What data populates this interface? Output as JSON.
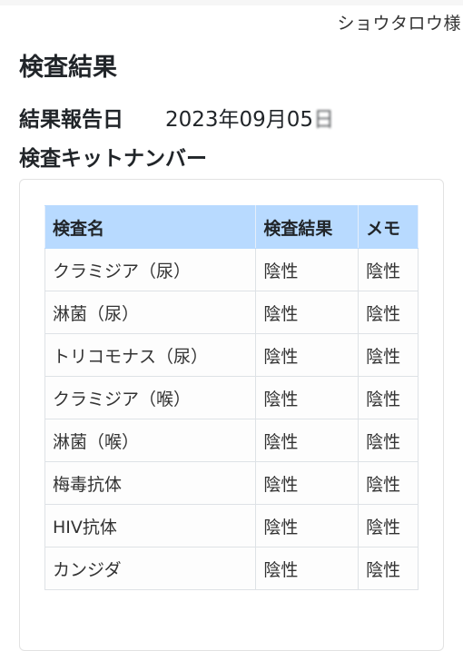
{
  "header": {
    "user_name": "ショウタロウ様"
  },
  "page": {
    "title": "検査結果",
    "report_date_label": "結果報告日",
    "report_date_value": "2023年09月05",
    "report_date_suffix": "日",
    "kit_number_label": "検査キットナンバー",
    "kit_number_value": ""
  },
  "table": {
    "columns": [
      "検査名",
      "検査結果",
      "メモ"
    ],
    "rows": [
      {
        "name": "クラミジア（尿）",
        "result": "陰性",
        "memo": "陰性"
      },
      {
        "name": "淋菌（尿）",
        "result": "陰性",
        "memo": "陰性"
      },
      {
        "name": "トリコモナス（尿）",
        "result": "陰性",
        "memo": "陰性"
      },
      {
        "name": "クラミジア（喉）",
        "result": "陰性",
        "memo": "陰性"
      },
      {
        "name": "淋菌（喉）",
        "result": "陰性",
        "memo": "陰性"
      },
      {
        "name": "梅毒抗体",
        "result": "陰性",
        "memo": "陰性"
      },
      {
        "name": "HIV抗体",
        "result": "陰性",
        "memo": "陰性"
      },
      {
        "name": "カンジダ",
        "result": "陰性",
        "memo": "陰性"
      }
    ]
  },
  "colors": {
    "header_bg": "#b8daff",
    "border": "#dee2e6",
    "text": "#212529"
  }
}
